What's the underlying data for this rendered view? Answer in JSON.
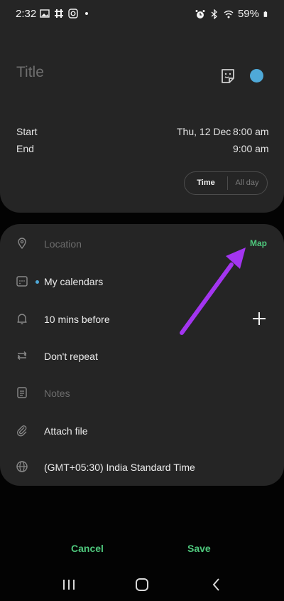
{
  "status": {
    "time": "2:32",
    "battery": "59%"
  },
  "event": {
    "title_placeholder": "Title",
    "start_label": "Start",
    "start_date": "Thu, 12 Dec",
    "start_time": "8:00 am",
    "end_label": "End",
    "end_time": "9:00 am",
    "toggle": {
      "time": "Time",
      "all_day": "All day"
    },
    "color": "#4fa9d8"
  },
  "details": {
    "location_placeholder": "Location",
    "map_label": "Map",
    "calendar": "My calendars",
    "reminder": "10 mins before",
    "repeat": "Don't repeat",
    "notes_placeholder": "Notes",
    "attach": "Attach file",
    "timezone": "(GMT+05:30) India Standard Time"
  },
  "footer": {
    "cancel": "Cancel",
    "save": "Save"
  },
  "colors": {
    "accent_green": "#4ec77c",
    "annotation_arrow": "#a335f0",
    "card_bg": "#252525"
  },
  "icons": [
    "gallery-icon",
    "slack-icon",
    "instagram-icon",
    "alarm-icon",
    "bluetooth-icon",
    "wifi-icon",
    "battery-icon",
    "sticker-icon",
    "location-pin-icon",
    "calendar-icon",
    "bell-icon",
    "repeat-icon",
    "notes-icon",
    "paperclip-icon",
    "globe-icon",
    "plus-icon",
    "recent-apps-icon",
    "home-icon",
    "back-icon"
  ]
}
